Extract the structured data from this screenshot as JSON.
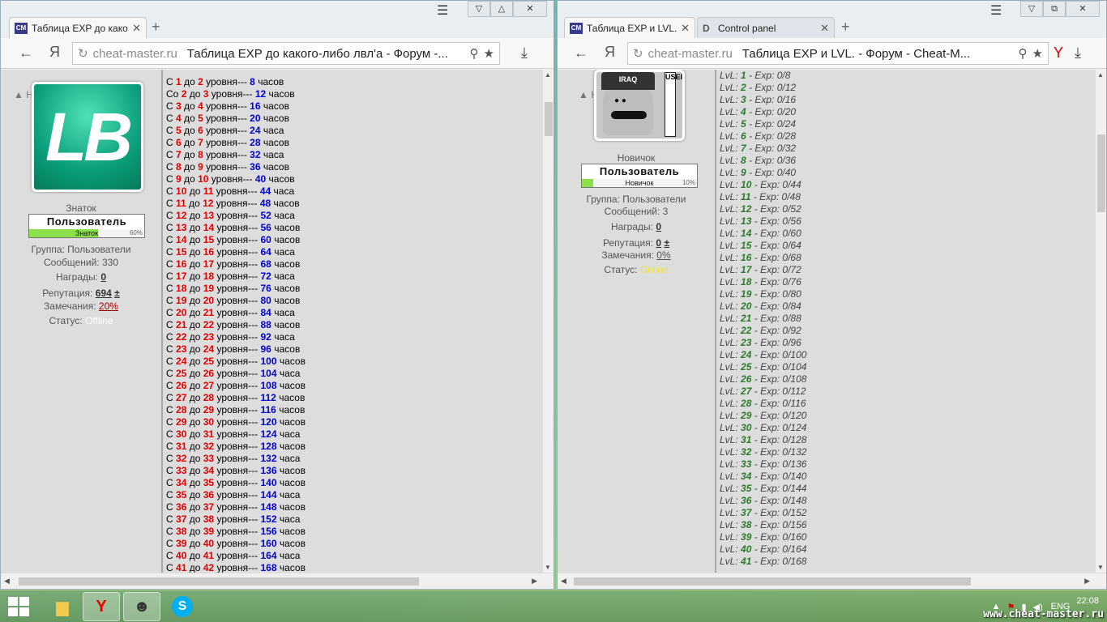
{
  "left": {
    "tabs": [
      {
        "label": "Таблица EXP до како",
        "favicon": "CM",
        "active": true
      }
    ],
    "address": {
      "domain": "cheat-master.ru",
      "title": "Таблица EXP до какого-либо лвл'а - Форум -..."
    },
    "sidebar": {
      "top_link": "▲ Наверх",
      "avatar_text": "LB",
      "rank": "Знаток",
      "rank_badge": "Пользователь",
      "rank_badge_sub": "Знаток",
      "rank_progress": "60%",
      "group": "Группа: Пользователи",
      "messages": "Сообщений: 330",
      "awards_label": "Награды:",
      "awards_value": "0",
      "rep_label": "Репутация:",
      "rep_value": "694",
      "rep_pm": "±",
      "warn_label": "Замечания:",
      "warn_value": "20%",
      "status_label": "Статус:",
      "status_value": "Offline"
    },
    "rows": [
      [
        "С",
        "1",
        "до",
        "2",
        "уровня---",
        "8",
        "часов"
      ],
      [
        "Со",
        "2",
        "до",
        "3",
        "уровня---",
        "12",
        "часов"
      ],
      [
        "С",
        "3",
        "до",
        "4",
        "уровня---",
        "16",
        "часов"
      ],
      [
        "С",
        "4",
        "до",
        "5",
        "уровня---",
        "20",
        "часов"
      ],
      [
        "С",
        "5",
        "до",
        "6",
        "уровня---",
        "24",
        "часа"
      ],
      [
        "С",
        "6",
        "до",
        "7",
        "уровня---",
        "28",
        "часов"
      ],
      [
        "С",
        "7",
        "до",
        "8",
        "уровня---",
        "32",
        "часа"
      ],
      [
        "С",
        "8",
        "до",
        "9",
        "уровня---",
        "36",
        "часов"
      ],
      [
        "С",
        "9",
        "до",
        "10",
        "уровня---",
        "40",
        "часов"
      ],
      [
        "С",
        "10",
        "до",
        "11",
        "уровня---",
        "44",
        "часа"
      ],
      [
        "С",
        "11",
        "до",
        "12",
        "уровня---",
        "48",
        "часов"
      ],
      [
        "С",
        "12",
        "до",
        "13",
        "уровня---",
        "52",
        "часа"
      ],
      [
        "С",
        "13",
        "до",
        "14",
        "уровня---",
        "56",
        "часов"
      ],
      [
        "С",
        "14",
        "до",
        "15",
        "уровня---",
        "60",
        "часов"
      ],
      [
        "С",
        "15",
        "до",
        "16",
        "уровня---",
        "64",
        "часа"
      ],
      [
        "С",
        "16",
        "до",
        "17",
        "уровня---",
        "68",
        "часов"
      ],
      [
        "С",
        "17",
        "до",
        "18",
        "уровня---",
        "72",
        "часа"
      ],
      [
        "С",
        "18",
        "до",
        "19",
        "уровня---",
        "76",
        "часов"
      ],
      [
        "С",
        "19",
        "до",
        "20",
        "уровня---",
        "80",
        "часов"
      ],
      [
        "С",
        "20",
        "до",
        "21",
        "уровня---",
        "84",
        "часа"
      ],
      [
        "С",
        "21",
        "до",
        "22",
        "уровня---",
        "88",
        "часов"
      ],
      [
        "С",
        "22",
        "до",
        "23",
        "уровня---",
        "92",
        "часа"
      ],
      [
        "С",
        "23",
        "до",
        "24",
        "уровня---",
        "96",
        "часов"
      ],
      [
        "С",
        "24",
        "до",
        "25",
        "уровня---",
        "100",
        "часов"
      ],
      [
        "С",
        "25",
        "до",
        "26",
        "уровня---",
        "104",
        "часа"
      ],
      [
        "С",
        "26",
        "до",
        "27",
        "уровня---",
        "108",
        "часов"
      ],
      [
        "С",
        "27",
        "до",
        "28",
        "уровня---",
        "112",
        "часов"
      ],
      [
        "С",
        "28",
        "до",
        "29",
        "уровня---",
        "116",
        "часов"
      ],
      [
        "С",
        "29",
        "до",
        "30",
        "уровня---",
        "120",
        "часов"
      ],
      [
        "С",
        "30",
        "до",
        "31",
        "уровня---",
        "124",
        "часа"
      ],
      [
        "С",
        "31",
        "до",
        "32",
        "уровня---",
        "128",
        "часов"
      ],
      [
        "С",
        "32",
        "до",
        "33",
        "уровня---",
        "132",
        "часа"
      ],
      [
        "С",
        "33",
        "до",
        "34",
        "уровня---",
        "136",
        "часов"
      ],
      [
        "С",
        "34",
        "до",
        "35",
        "уровня---",
        "140",
        "часов"
      ],
      [
        "С",
        "35",
        "до",
        "36",
        "уровня---",
        "144",
        "часа"
      ],
      [
        "С",
        "36",
        "до",
        "37",
        "уровня---",
        "148",
        "часов"
      ],
      [
        "С",
        "37",
        "до",
        "38",
        "уровня---",
        "152",
        "часа"
      ],
      [
        "С",
        "38",
        "до",
        "39",
        "уровня---",
        "156",
        "часов"
      ],
      [
        "С",
        "39",
        "до",
        "40",
        "уровня---",
        "160",
        "часов"
      ],
      [
        "С",
        "40",
        "до",
        "41",
        "уровня---",
        "164",
        "часа"
      ],
      [
        "С",
        "41",
        "до",
        "42",
        "уровня---",
        "168",
        "часов"
      ]
    ]
  },
  "right": {
    "tabs": [
      {
        "label": "Таблица EXP и LVL. -",
        "favicon": "CM",
        "active": true
      },
      {
        "label": "Control panel",
        "favicon": "D",
        "active": false
      }
    ],
    "address": {
      "domain": "cheat-master.ru",
      "title": "Таблица EXP и LVL. - Форум - Cheat-M..."
    },
    "sidebar": {
      "top_link": "▲ Навер",
      "hat_text": "IRAQ",
      "vert_text": "USEIN",
      "rank": "Новичок",
      "rank_badge": "Пользователь",
      "rank_badge_sub": "Новичок",
      "rank_progress": "10%",
      "group": "Группа: Пользователи",
      "messages": "Сообщений: 3",
      "awards_label": "Награды:",
      "awards_value": "0",
      "rep_label": "Репутация:",
      "rep_value": "0",
      "rep_pm": "±",
      "warn_label": "Замечания:",
      "warn_value": "0%",
      "status_label": "Статус:",
      "status_value": "Online"
    },
    "lvl_prefix": "LvL:",
    "exp_prefix": "- Exp: 0/",
    "levels": [
      [
        1,
        8
      ],
      [
        2,
        12
      ],
      [
        3,
        16
      ],
      [
        4,
        20
      ],
      [
        5,
        24
      ],
      [
        6,
        28
      ],
      [
        7,
        32
      ],
      [
        8,
        36
      ],
      [
        9,
        40
      ],
      [
        10,
        44
      ],
      [
        11,
        48
      ],
      [
        12,
        52
      ],
      [
        13,
        56
      ],
      [
        14,
        60
      ],
      [
        15,
        64
      ],
      [
        16,
        68
      ],
      [
        17,
        72
      ],
      [
        18,
        76
      ],
      [
        19,
        80
      ],
      [
        20,
        84
      ],
      [
        21,
        88
      ],
      [
        22,
        92
      ],
      [
        23,
        96
      ],
      [
        24,
        100
      ],
      [
        25,
        104
      ],
      [
        26,
        108
      ],
      [
        27,
        112
      ],
      [
        28,
        116
      ],
      [
        29,
        120
      ],
      [
        30,
        124
      ],
      [
        31,
        128
      ],
      [
        32,
        132
      ],
      [
        33,
        136
      ],
      [
        34,
        140
      ],
      [
        35,
        144
      ],
      [
        36,
        148
      ],
      [
        37,
        152
      ],
      [
        38,
        156
      ],
      [
        39,
        160
      ],
      [
        40,
        164
      ],
      [
        41,
        168
      ]
    ]
  },
  "taskbar": {
    "lang": "ENG",
    "time": "22:08",
    "watermark": "www.cheat-master.ru"
  }
}
